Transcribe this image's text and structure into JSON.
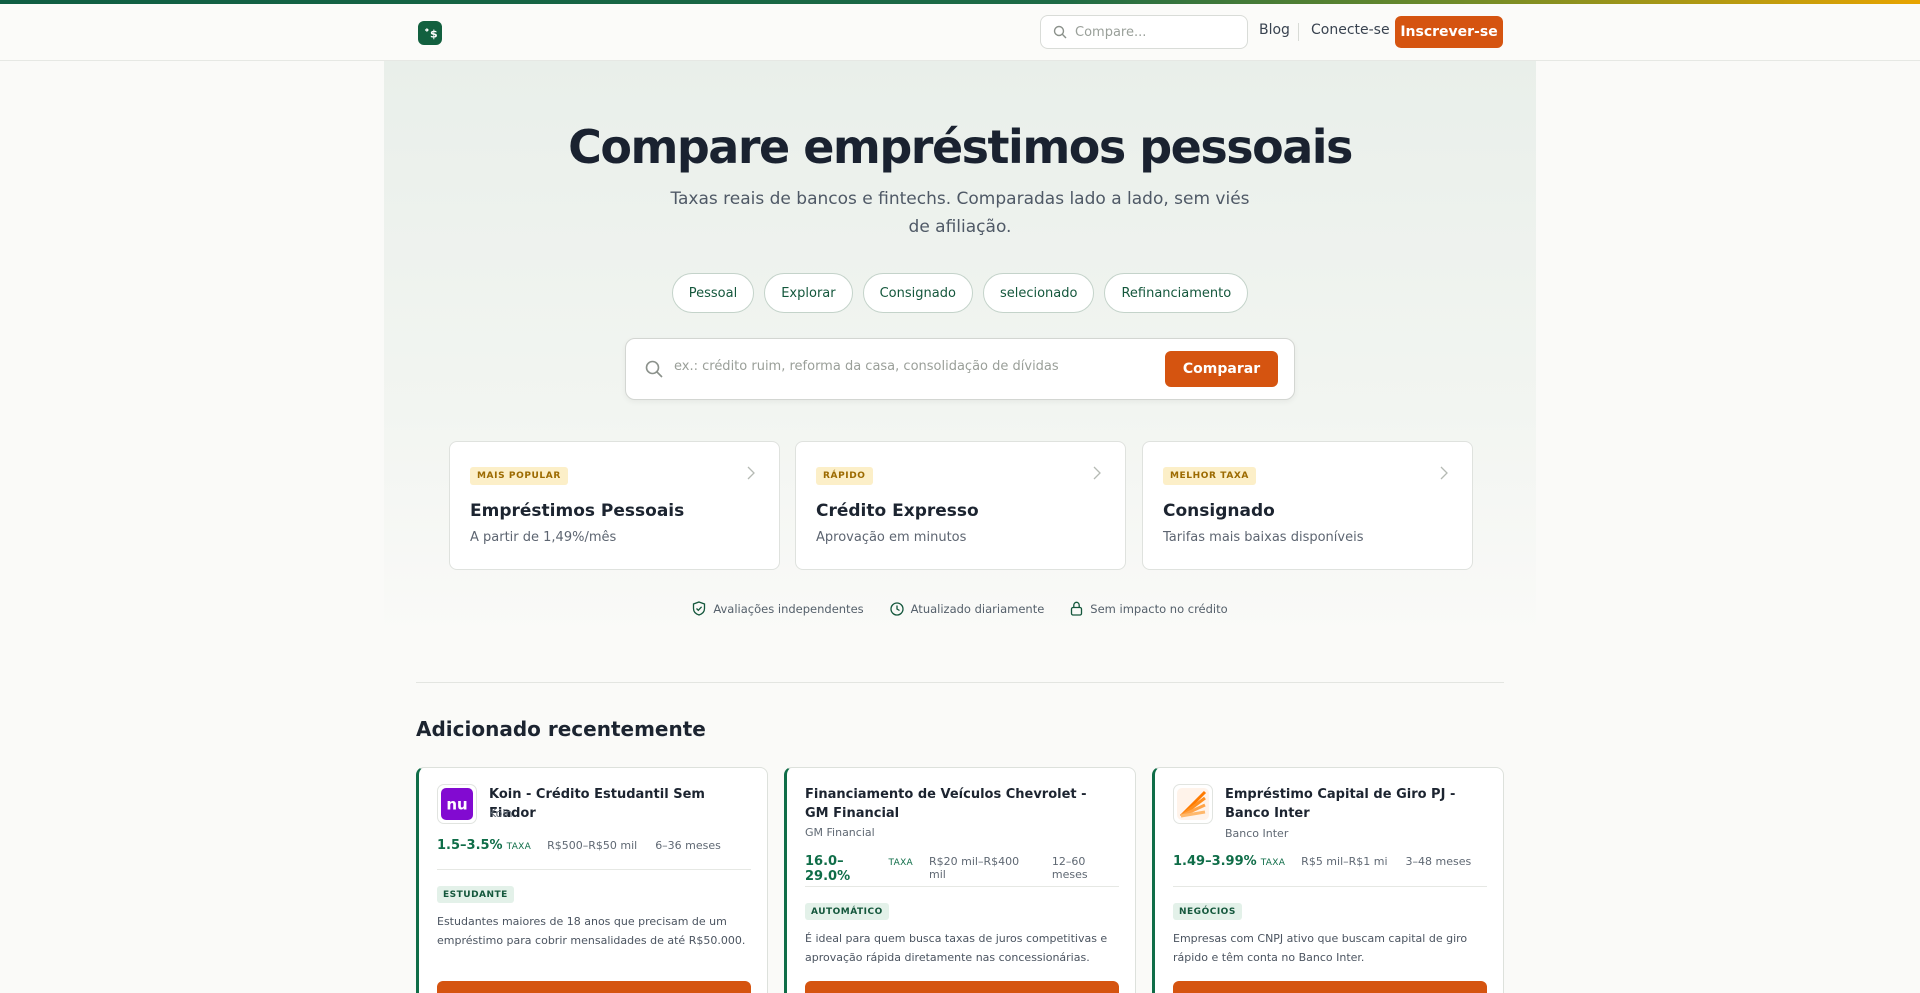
{
  "colors": {
    "brand_green": "#0f5e43",
    "accent_orange": "#d55410",
    "badge_yellow": "#fcefc8",
    "tag_green": "#e3f1e9"
  },
  "nav": {
    "logo_icon": "dollar-logo-icon",
    "search_placeholder": "Compare...",
    "blog": "Blog",
    "login": "Conecte-se",
    "signup": "Inscrever-se"
  },
  "hero": {
    "title": "Compare empréstimos pessoais",
    "subtitle": "Taxas reais de bancos e fintechs. Comparadas lado a lado, sem viés de afiliação.",
    "chips": [
      "Pessoal",
      "Explorar",
      "Consignado",
      "selecionado",
      "Refinanciamento"
    ],
    "search_placeholder": "ex.: crédito ruim, reforma da casa, consolidação de dívidas",
    "compare_button": "Comparar"
  },
  "categories": [
    {
      "badge": "MAIS POPULAR",
      "title": "Empréstimos Pessoais",
      "desc": "A partir de 1,49%/mês"
    },
    {
      "badge": "RÁPIDO",
      "title": "Crédito Expresso",
      "desc": "Aprovação em minutos"
    },
    {
      "badge": "MELHOR TAXA",
      "title": "Consignado",
      "desc": "Tarifas mais baixas disponíveis"
    }
  ],
  "trust": [
    {
      "icon": "shield-check-icon",
      "label": "Avaliações independentes"
    },
    {
      "icon": "clock-icon",
      "label": "Atualizado diariamente"
    },
    {
      "icon": "lock-icon",
      "label": "Sem impacto no crédito"
    }
  ],
  "recent": {
    "title": "Adicionado recentemente",
    "cards": [
      {
        "logo": "nu-logo",
        "title": "Koin - Crédito Estudantil Sem Fiador",
        "provider": "Koin",
        "rate": "1.5–3.5%",
        "rate_label": "TAXA",
        "amount": "R$500–R$50 mil",
        "term": "6–36 meses",
        "tag": "ESTUDANTE",
        "desc": "Estudantes maiores de 18 anos que precisam de um empréstimo para cobrir mensalidades de até R$50.000."
      },
      {
        "logo": "",
        "title": "Financiamento de Veículos Chevrolet - GM Financial",
        "provider": "GM Financial",
        "rate": "16.0–29.0%",
        "rate_label": "TAXA",
        "amount": "R$20 mil–R$400 mil",
        "term": "12–60 meses",
        "tag": "AUTOMÁTICO",
        "desc": "É ideal para quem busca taxas de juros competitivas e aprovação rápida diretamente nas concessionárias."
      },
      {
        "logo": "inter-logo",
        "title": "Empréstimo Capital de Giro PJ - Banco Inter",
        "provider": "Banco Inter",
        "rate": "1.49–3.99%",
        "rate_label": "TAXA",
        "amount": "R$5 mil–R$1 mi",
        "term": "3–48 meses",
        "tag": "NEGÓCIOS",
        "desc": "Empresas com CNPJ ativo que buscam capital de giro rápido e têm conta no Banco Inter."
      }
    ]
  }
}
